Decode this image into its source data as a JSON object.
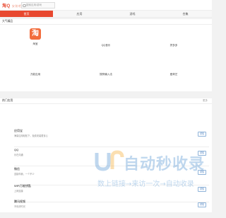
{
  "header": {
    "logo_main": "淘Q",
    "logo_sub": "安装吧",
    "search_placeholder": "搜索应用/游戏"
  },
  "nav": {
    "tabs": [
      "首页",
      "应用",
      "游戏",
      "合集"
    ],
    "active": 0
  },
  "hot_apps": {
    "title": "大气精品",
    "items": [
      {
        "label": "淘宝",
        "icon": "taobao-icon"
      },
      {
        "label": "QQ音乐",
        "icon": "qq-music-icon"
      },
      {
        "label": "拼多多",
        "icon": "pinduoduo-icon"
      },
      {
        "label": "万能应用",
        "icon": "app-icon"
      },
      {
        "label": "搜狗输入法",
        "icon": "input-method-icon"
      },
      {
        "label": "爱奇艺",
        "icon": "video-icon"
      }
    ]
  },
  "popular": {
    "title": "热门应用",
    "more": "更多",
    "items": [
      {
        "title": "应用宝",
        "sub": "海量应用轻松下，免费安装更省心",
        "button": "详情"
      },
      {
        "title": "QQ",
        "sub": "乐在沟通",
        "button": "详情"
      },
      {
        "title": "微信",
        "sub": "连接你我，一个不少",
        "button": "详情"
      },
      {
        "title": "WiFi万能钥匙",
        "sub": "上网连接",
        "button": "详情"
      },
      {
        "title": "腾讯视频",
        "sub": "不负好时光",
        "button": "详情"
      }
    ]
  },
  "watermark": {
    "title": "自动秒收录",
    "subtitle": "数上链接→来访一次→自动收录"
  },
  "colors": {
    "accent": "#e8482f",
    "link": "#4a7fbf",
    "watermark": "#4a90d0"
  }
}
